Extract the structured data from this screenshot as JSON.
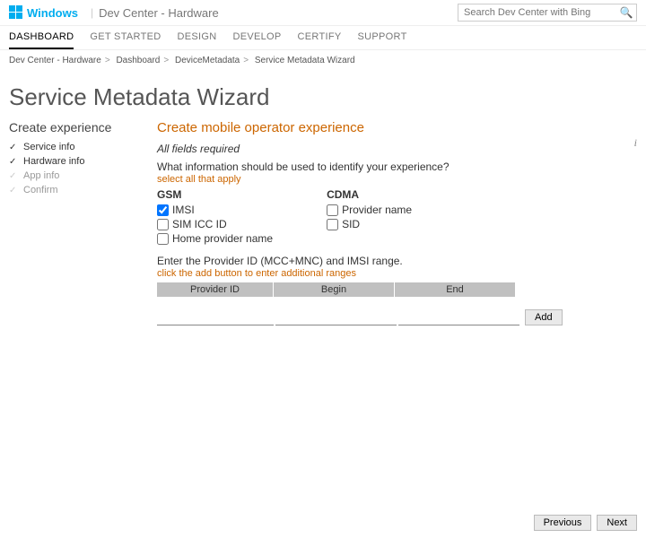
{
  "header": {
    "windows": "Windows",
    "site": "Dev Center - Hardware",
    "search_placeholder": "Search Dev Center with Bing"
  },
  "nav": {
    "tabs": [
      "DASHBOARD",
      "GET STARTED",
      "DESIGN",
      "DEVELOP",
      "CERTIFY",
      "SUPPORT"
    ],
    "active": 0
  },
  "breadcrumb": [
    "Dev Center - Hardware",
    "Dashboard",
    "DeviceMetadata",
    "Service Metadata Wizard"
  ],
  "page_title": "Service Metadata Wizard",
  "sidebar": {
    "title": "Create experience",
    "steps": [
      {
        "label": "Service info",
        "done": true
      },
      {
        "label": "Hardware info",
        "done": true
      },
      {
        "label": "App info",
        "done": false
      },
      {
        "label": "Confirm",
        "done": false
      }
    ]
  },
  "form": {
    "heading": "Create mobile operator experience",
    "required": "All fields required",
    "prompt": "What information should be used to identify your experience?",
    "hint1": "select all that apply",
    "gsm": {
      "title": "GSM",
      "opts": [
        {
          "label": "IMSI",
          "checked": true
        },
        {
          "label": "SIM ICC ID",
          "checked": false
        },
        {
          "label": "Home provider name",
          "checked": false
        }
      ]
    },
    "cdma": {
      "title": "CDMA",
      "opts": [
        {
          "label": "Provider name",
          "checked": false
        },
        {
          "label": "SID",
          "checked": false
        }
      ]
    },
    "range_prompt": "Enter the Provider ID (MCC+MNC) and IMSI range.",
    "hint2": "click the add button to enter additional ranges",
    "cols": [
      "Provider ID",
      "Begin",
      "End"
    ],
    "add": "Add"
  },
  "footer": {
    "prev": "Previous",
    "next": "Next"
  }
}
